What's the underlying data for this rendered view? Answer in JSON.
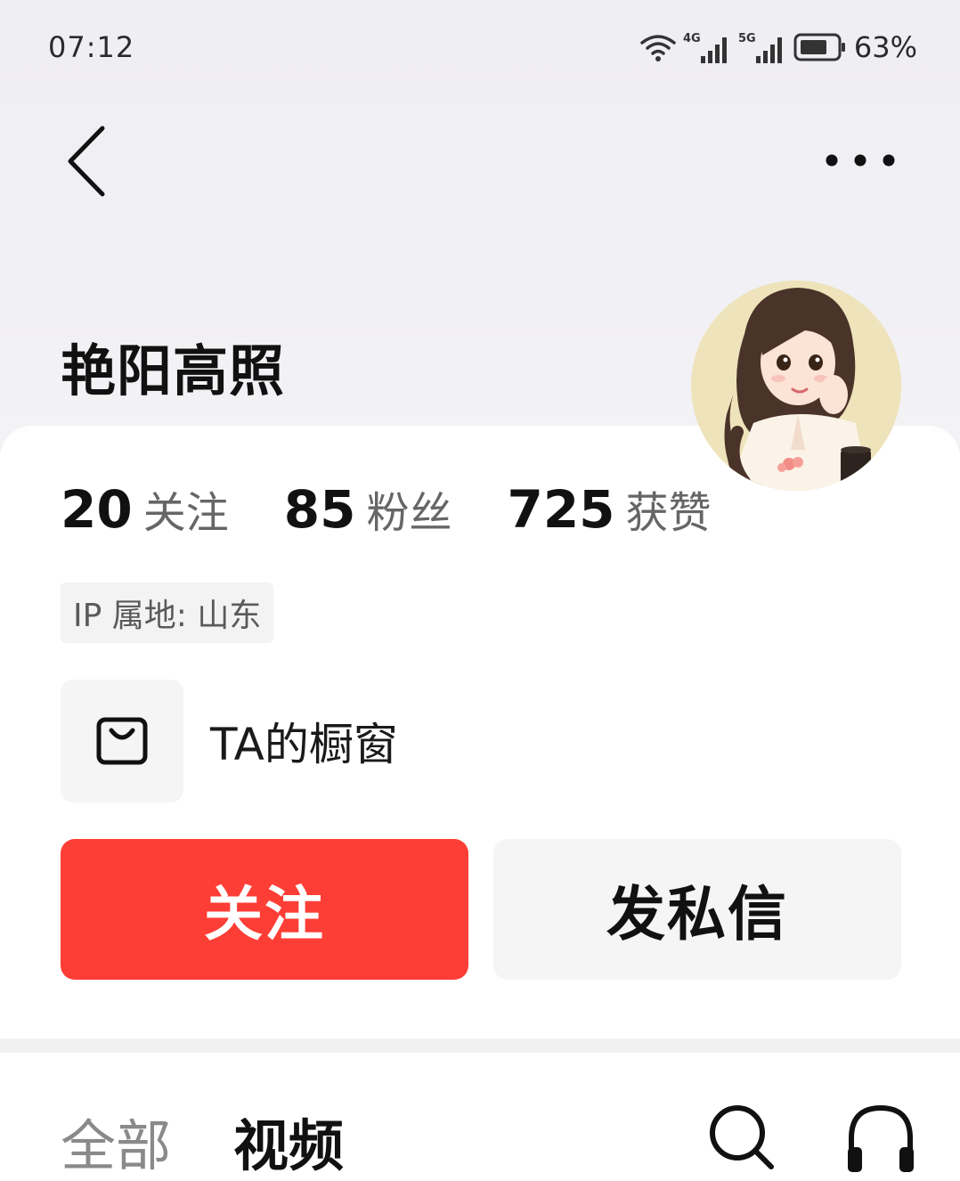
{
  "status_bar": {
    "time": "07:12",
    "net1": "4G",
    "net2": "5G",
    "battery_percent": "63%",
    "icons": [
      "wifi-icon",
      "signal-4g-icon",
      "signal-5g-icon",
      "battery-icon"
    ]
  },
  "nav": {
    "back_icon": "chevron-left-icon",
    "more_icon": "more-dots-icon"
  },
  "profile": {
    "username": "艳阳高照",
    "avatar": "avatar-illustration-girl"
  },
  "stats": [
    {
      "num": "20",
      "label": "关注"
    },
    {
      "num": "85",
      "label": "粉丝"
    },
    {
      "num": "725",
      "label": "获赞"
    }
  ],
  "ip_location": "IP 属地: 山东",
  "shop": {
    "icon": "shopping-bag-icon",
    "label": "TA的橱窗"
  },
  "actions": {
    "follow": "关注",
    "message": "发私信"
  },
  "tabs": {
    "all": "全部",
    "video": "视频",
    "search_icon": "search-icon",
    "listen_icon": "headphones-icon"
  },
  "colors": {
    "accent": "#fd3e36",
    "hero_bg": "#efeef3"
  }
}
